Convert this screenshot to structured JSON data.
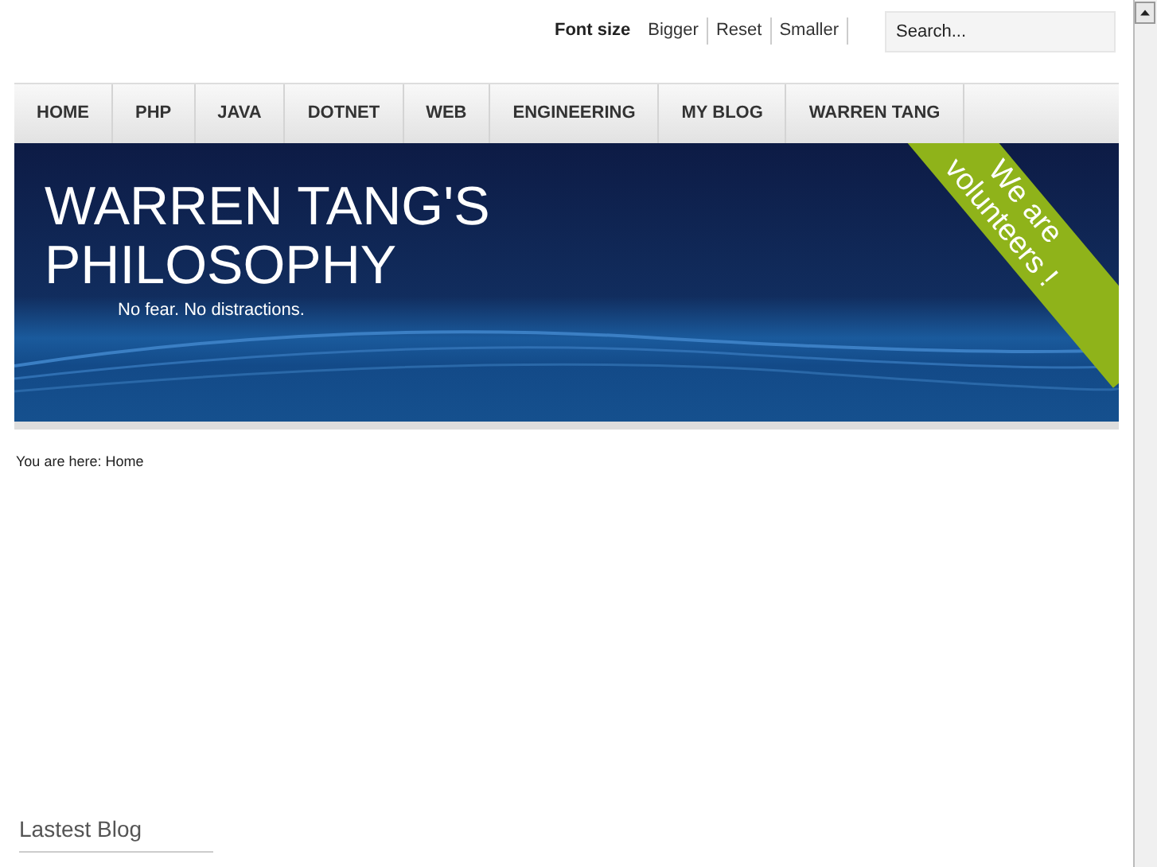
{
  "font_size_tools": {
    "label": "Font size",
    "links": [
      "Bigger",
      "Reset",
      "Smaller"
    ]
  },
  "search": {
    "placeholder": "Search..."
  },
  "menu": [
    {
      "label": "HOME"
    },
    {
      "label": "PHP"
    },
    {
      "label": "JAVA"
    },
    {
      "label": "DOTNET"
    },
    {
      "label": "WEB"
    },
    {
      "label": "ENGINEERING"
    },
    {
      "label": "MY BLOG"
    },
    {
      "label": "WARREN TANG"
    }
  ],
  "banner": {
    "title_lines": [
      "WARREN TANG'S",
      "PHILOSOPHY"
    ],
    "tagline": "No fear. No distractions.",
    "ribbon_lines": [
      "We are",
      "volunteers !"
    ]
  },
  "breadcrumb": "You are here: Home",
  "sidebar": {
    "heading": "Lastest Blog"
  }
}
